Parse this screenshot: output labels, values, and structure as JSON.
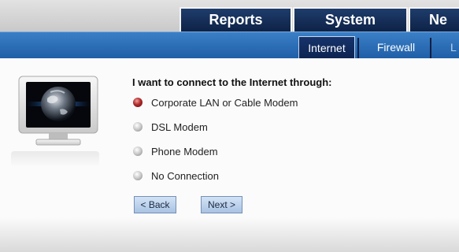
{
  "tabs": {
    "reports": "Reports",
    "system": "System",
    "network_partial": "Ne"
  },
  "subnav": {
    "internet": "Internet",
    "firewall": "Firewall",
    "more_partial": "L"
  },
  "prompt": "I want to connect to the Internet through:",
  "options": [
    {
      "label": "Corporate LAN or Cable Modem",
      "selected": true
    },
    {
      "label": "DSL Modem",
      "selected": false
    },
    {
      "label": "Phone Modem",
      "selected": false
    },
    {
      "label": "No Connection",
      "selected": false
    }
  ],
  "buttons": {
    "back": "< Back",
    "next": "Next >"
  },
  "colors": {
    "tab_bg": "#132c58",
    "subnav_bg": "#2e6fb8",
    "radio_selected": "#b02a2a"
  }
}
